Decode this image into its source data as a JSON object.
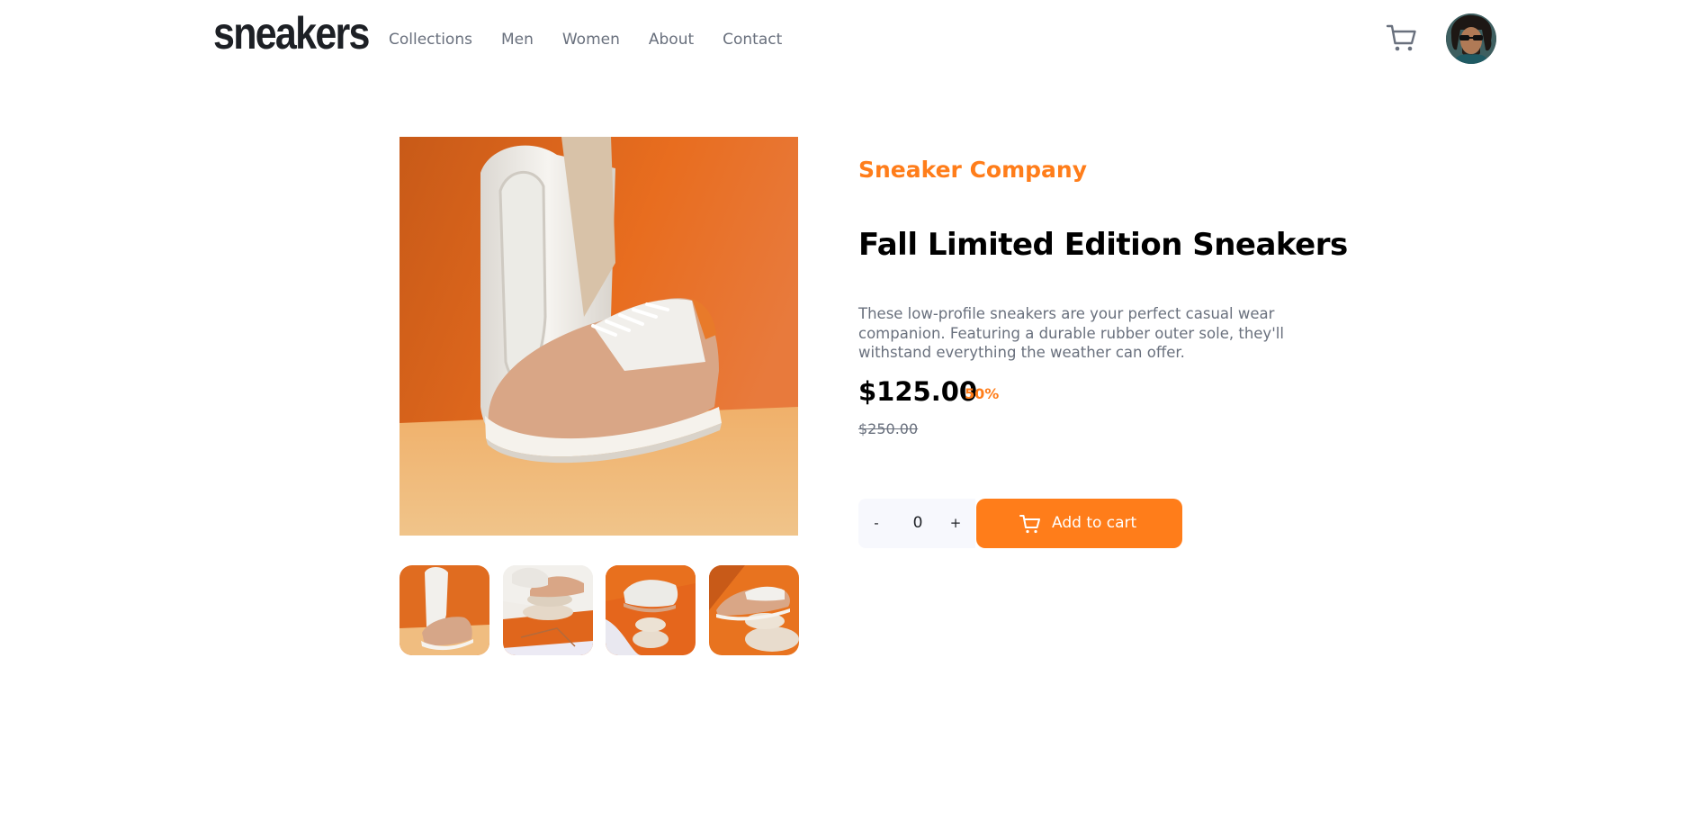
{
  "header": {
    "logo": "sneakers",
    "nav": [
      "Collections",
      "Men",
      "Women",
      "About",
      "Contact"
    ],
    "cart_icon": "cart-icon",
    "avatar": "user-avatar"
  },
  "gallery": {
    "main_image": "sneaker-photo-main",
    "thumbnails": [
      "sneaker-thumb-1",
      "sneaker-thumb-2",
      "sneaker-thumb-3",
      "sneaker-thumb-4"
    ]
  },
  "product": {
    "company": "Sneaker Company",
    "title": "Fall Limited Edition Sneakers",
    "description": "These low-profile sneakers are your perfect casual wear companion. Featuring a durable rubber outer sole, they'll withstand everything the weather can offer.",
    "price": "$125.00",
    "discount": "50%",
    "old_price": "$250.00"
  },
  "cart_controls": {
    "minus": "-",
    "quantity": "0",
    "plus": "+",
    "add_label": "Add to cart"
  },
  "colors": {
    "accent": "#ff7d1a",
    "text_dark": "#1d2025",
    "text_muted": "#69707d",
    "qty_bg": "#f7f8fd"
  }
}
